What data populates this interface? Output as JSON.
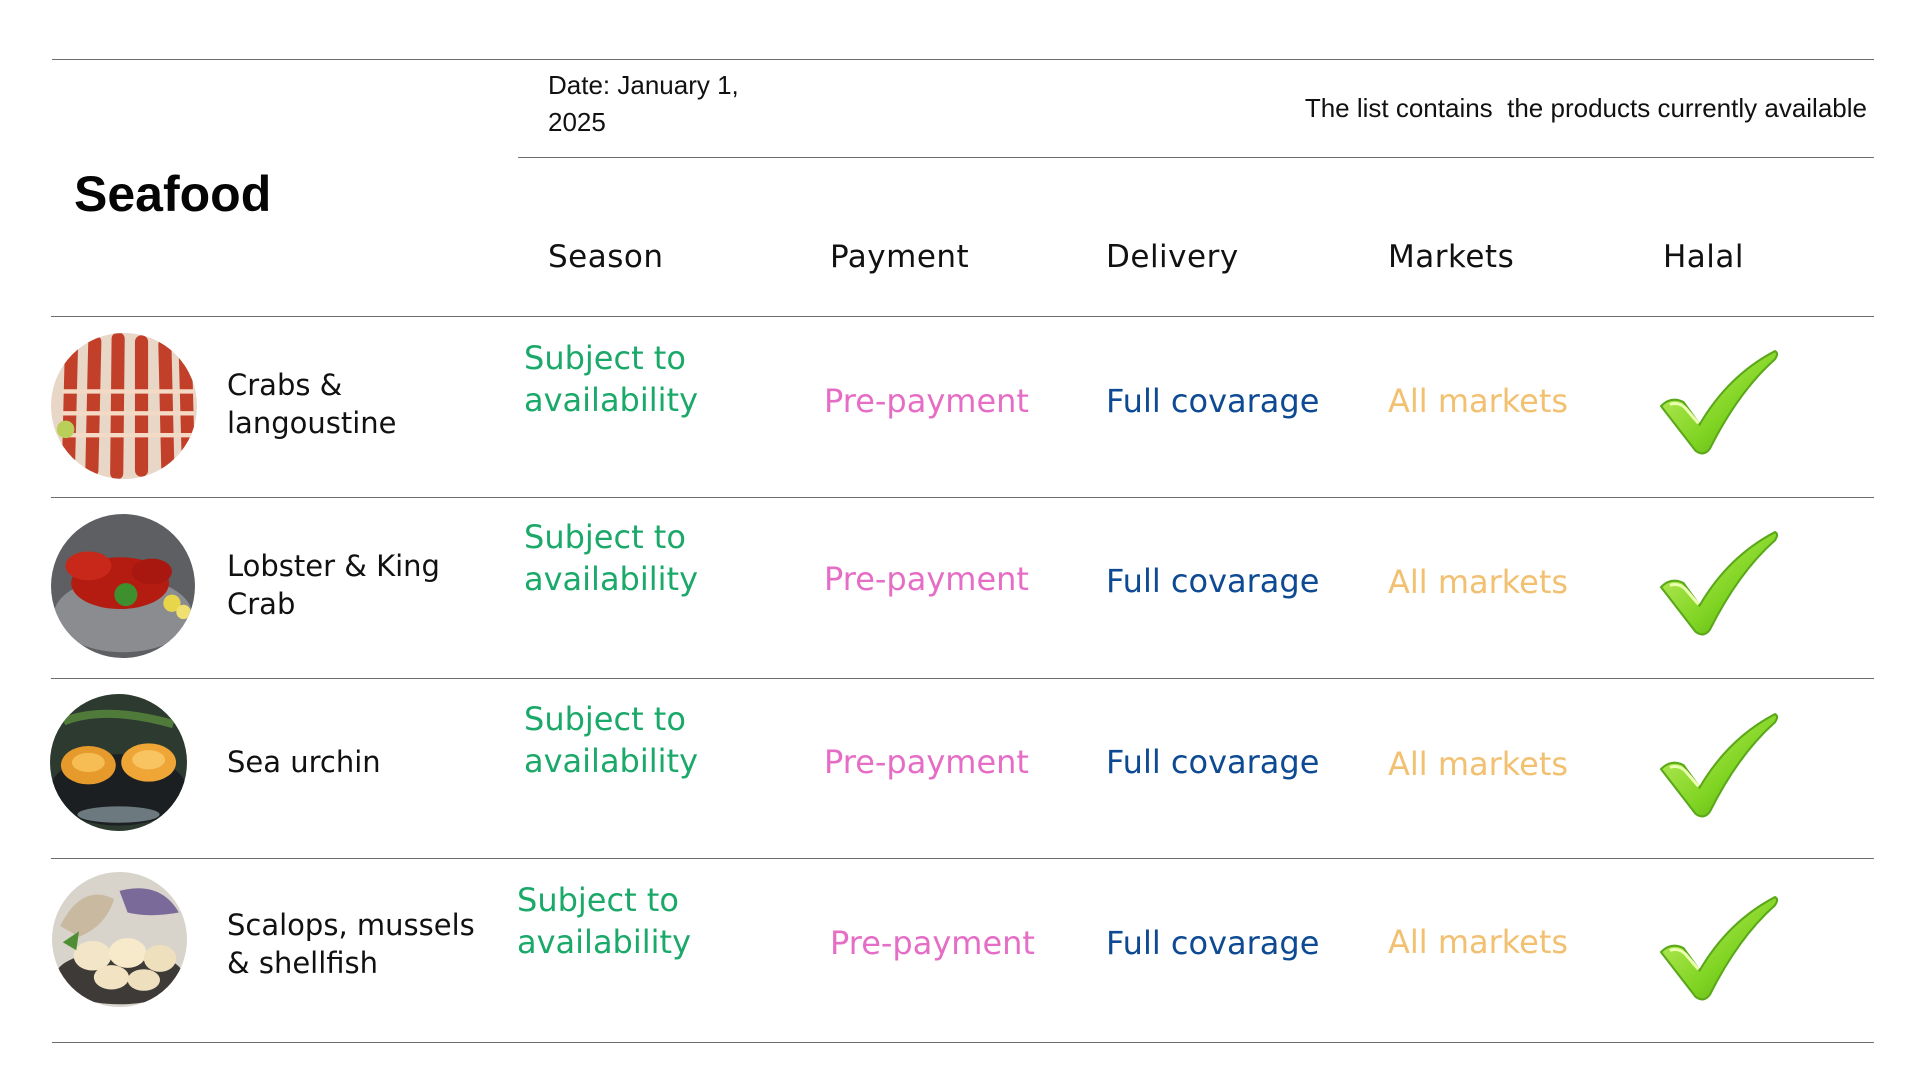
{
  "header": {
    "date": "Date: January 1, 2025",
    "note": "The list contains  the products currently available",
    "title": "Seafood"
  },
  "columns": [
    "Season",
    "Payment",
    "Delivery",
    "Markets",
    "Halal"
  ],
  "products": [
    {
      "name": "Crabs & langoustine",
      "season": "Subject to availability",
      "payment": "Pre-payment",
      "delivery": "Full covarage",
      "markets": "All markets",
      "halal": true
    },
    {
      "name": "Lobster & King Crab",
      "season": "Subject to availability",
      "payment": "Pre-payment",
      "delivery": "Full covarage",
      "markets": "All markets",
      "halal": true
    },
    {
      "name": "Sea urchin",
      "season": "Subject to availability",
      "payment": "Pre-payment",
      "delivery": "Full covarage",
      "markets": "All markets",
      "halal": true
    },
    {
      "name": "Scalops, mussels & shellfish",
      "season": "Subject to availability",
      "payment": "Pre-payment",
      "delivery": "Full covarage",
      "markets": "All markets",
      "halal": true
    }
  ],
  "colors": {
    "season": "#1ba96a",
    "payment": "#e56dc6",
    "delivery": "#0e4a93",
    "markets": "#f2c071",
    "halal_check": "#7ed321"
  },
  "icons": {
    "halal": "green-checkmark-icon"
  }
}
